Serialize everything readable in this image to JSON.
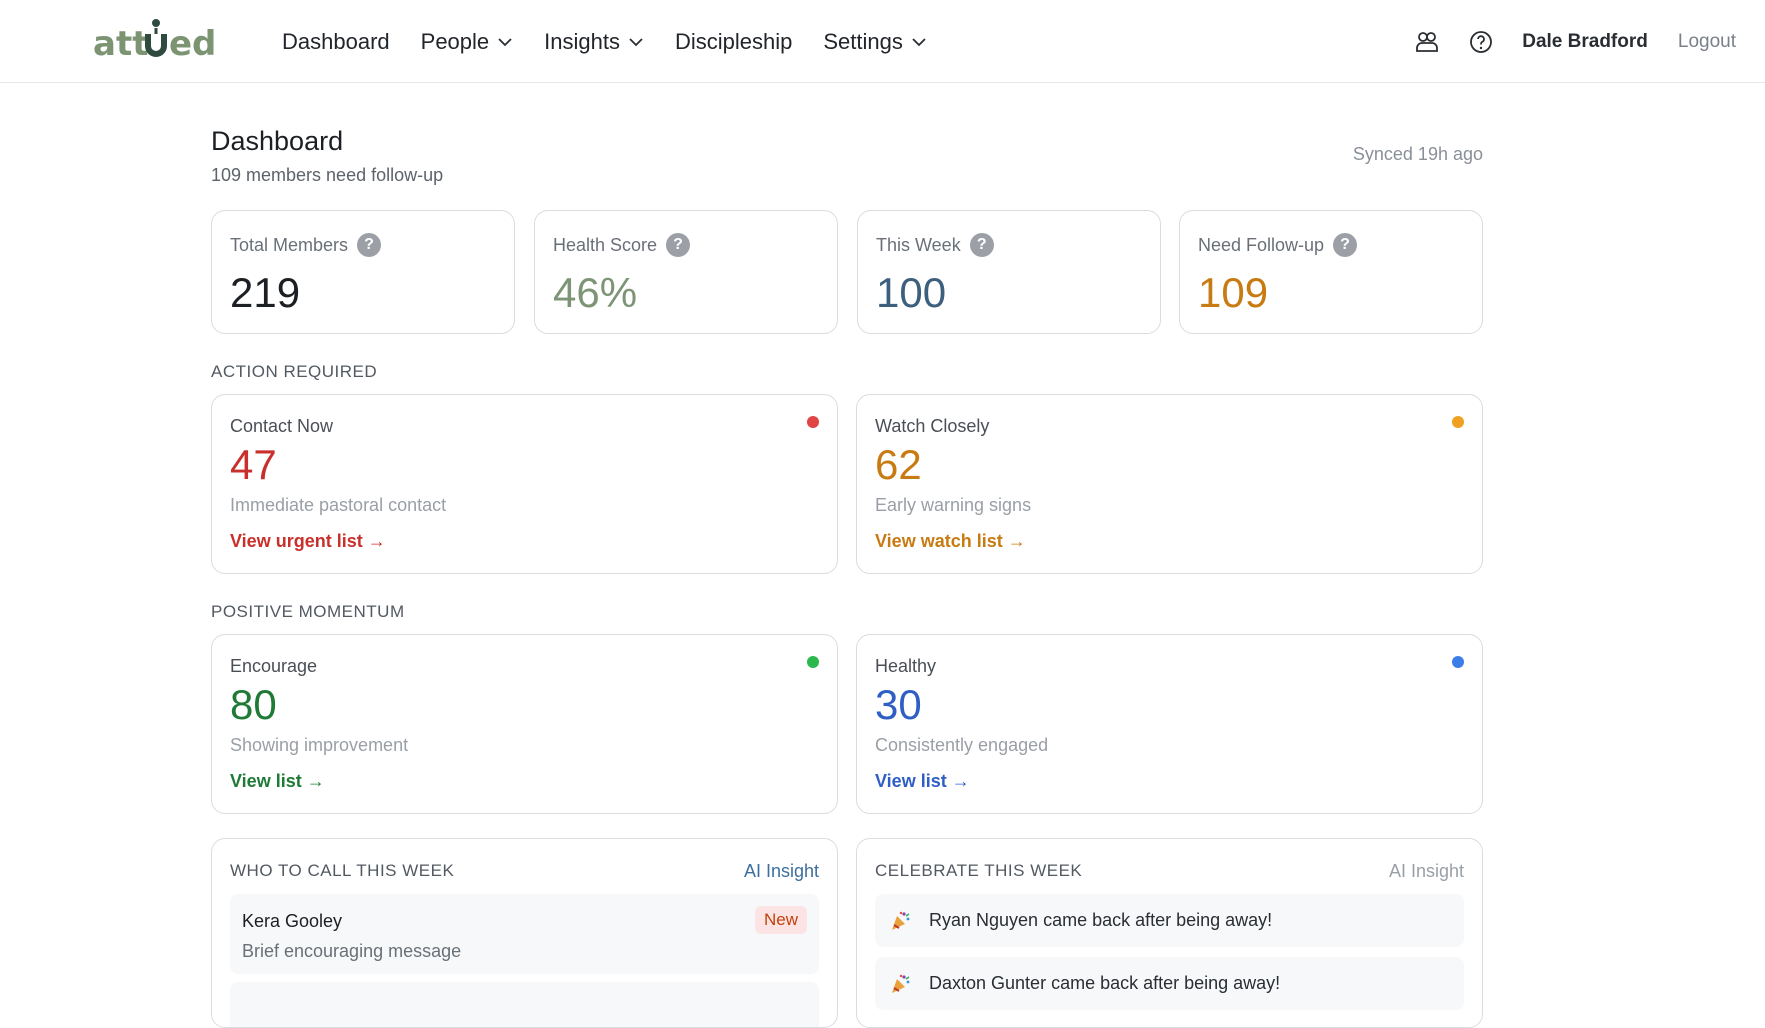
{
  "header": {
    "logo_text": "attuned",
    "nav": [
      {
        "label": "Dashboard",
        "dropdown": false
      },
      {
        "label": "People",
        "dropdown": true
      },
      {
        "label": "Insights",
        "dropdown": true
      },
      {
        "label": "Discipleship",
        "dropdown": false
      },
      {
        "label": "Settings",
        "dropdown": true
      }
    ],
    "user_name": "Dale Bradford",
    "logout_label": "Logout",
    "icons": [
      "people-icon",
      "help-icon"
    ]
  },
  "page": {
    "title": "Dashboard",
    "subtitle": "109 members need follow-up",
    "synced": "Synced 19h ago"
  },
  "stats": [
    {
      "label": "Total Members",
      "value": "219",
      "color": "#1c1f23"
    },
    {
      "label": "Health Score",
      "value": "46%",
      "color": "#7d9476"
    },
    {
      "label": "This Week",
      "value": "100",
      "color": "#3d5f7e"
    },
    {
      "label": "Need Follow-up",
      "value": "109",
      "color": "#c87b12"
    }
  ],
  "sections": {
    "action": "ACTION REQUIRED",
    "momentum": "POSITIVE MOMENTUM"
  },
  "cards": [
    {
      "title": "Contact Now",
      "value": "47",
      "desc": "Immediate pastoral contact",
      "link": "View urgent list →",
      "color": "#c9302c",
      "dot": "#e04444"
    },
    {
      "title": "Watch Closely",
      "value": "62",
      "desc": "Early warning signs",
      "link": "View watch list →",
      "color": "#c87b12",
      "dot": "#f0a020"
    },
    {
      "title": "Encourage",
      "value": "80",
      "desc": "Showing improvement",
      "link": "View list →",
      "color": "#1f7a36",
      "dot": "#2db84d"
    },
    {
      "title": "Healthy",
      "value": "30",
      "desc": "Consistently engaged",
      "link": "View list →",
      "color": "#2f5fc4",
      "dot": "#3b7ee8"
    }
  ],
  "who_to_call": {
    "heading": "WHO TO CALL THIS WEEK",
    "ai_label": "AI Insight",
    "ai_color": "#3d6e9e",
    "items": [
      {
        "name": "Kera Gooley",
        "message": "Brief encouraging message",
        "badge": "New"
      }
    ]
  },
  "celebrate": {
    "heading": "CELEBRATE THIS WEEK",
    "ai_label": "AI Insight",
    "ai_color": "#9aa0a8",
    "items": [
      {
        "text": "Ryan Nguyen came back after being away!",
        "icon": "party-popper-icon"
      },
      {
        "text": "Daxton Gunter came back after being away!",
        "icon": "party-popper-icon"
      }
    ]
  }
}
